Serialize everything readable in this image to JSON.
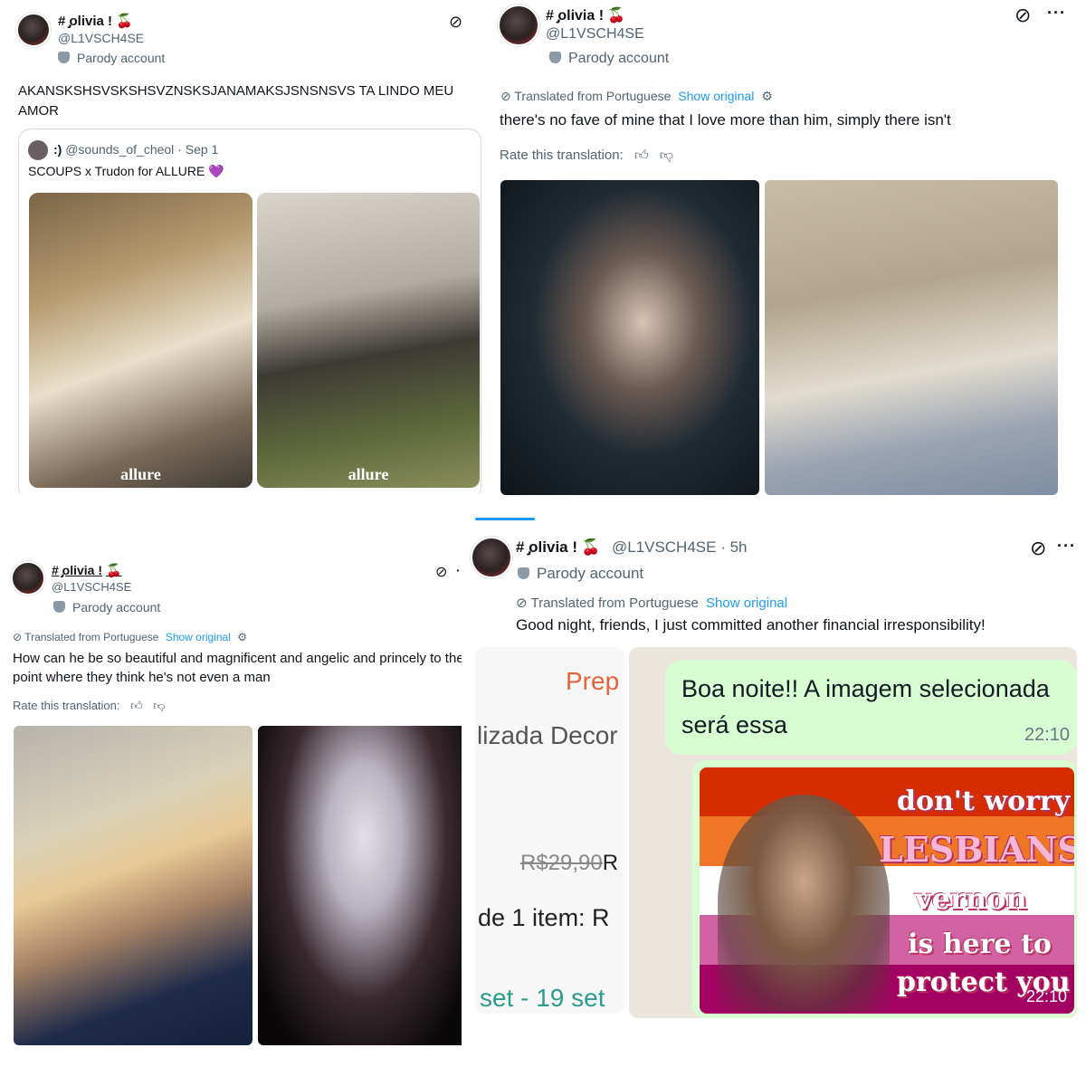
{
  "posts": [
    {
      "display_name": "# ̡olivia !",
      "handle": "@L1VSCH4SE",
      "parody_label": "Parody account",
      "grok_icon": "grok-icon",
      "text": "AKANSKSHSVSKSHSVZNSKSJANAMAKSJSNSNSVS TA LINDO MEU AMOR",
      "quote": {
        "name": ":)",
        "handle_date": "@sounds_of_cheol · Sep 1",
        "text": "SCOUPS x Trudon for ALLURE 💜",
        "watermark": "allure"
      }
    },
    {
      "display_name": "# ̡olivia !",
      "handle": "@L1VSCH4SE",
      "parody_label": "Parody account",
      "translated_label": "Translated from Portuguese",
      "show_original": "Show original",
      "text": "there's no fave of mine that I love more than him, simply there isn't",
      "rate_label": "Rate this translation:"
    },
    {
      "display_name": "# ̡olivia !",
      "handle": "@L1VSCH4SE",
      "parody_label": "Parody account",
      "translated_label": "Translated from Portuguese",
      "show_original": "Show original",
      "text": "How can he be so beautiful and magnificent and angelic and princely to the point where they think he's not even a man",
      "rate_label": "Rate this translation:"
    },
    {
      "display_name": "# ̡olivia !",
      "handle_time": "@L1VSCH4SE · 5h",
      "parody_label": "Parody account",
      "translated_label": "Translated from Portuguese",
      "show_original": "Show original",
      "text": "Good night, friends, I just committed another financial irresponsibility!",
      "shop": {
        "prep": "Prep",
        "title": "lizada Decor",
        "price_old": "R$29,90",
        "price_new": "R",
        "items": "de 1 item: R",
        "dates": "set - 19 set"
      },
      "chat": {
        "message": "Boa noite!! A imagem selecionada será essa",
        "time": "22:10",
        "image_lines": [
          "don't worry",
          "LESBIANS",
          "vernon",
          "is here to",
          "protect you"
        ],
        "image_time": "22:10"
      }
    }
  ],
  "colors": {
    "link": "#1d9bf0",
    "muted": "#536471",
    "chat_bubble": "#d9fdd3",
    "flag": [
      "#d52d00",
      "#ef7627",
      "#ffffff",
      "#d162a4",
      "#a30262"
    ]
  }
}
